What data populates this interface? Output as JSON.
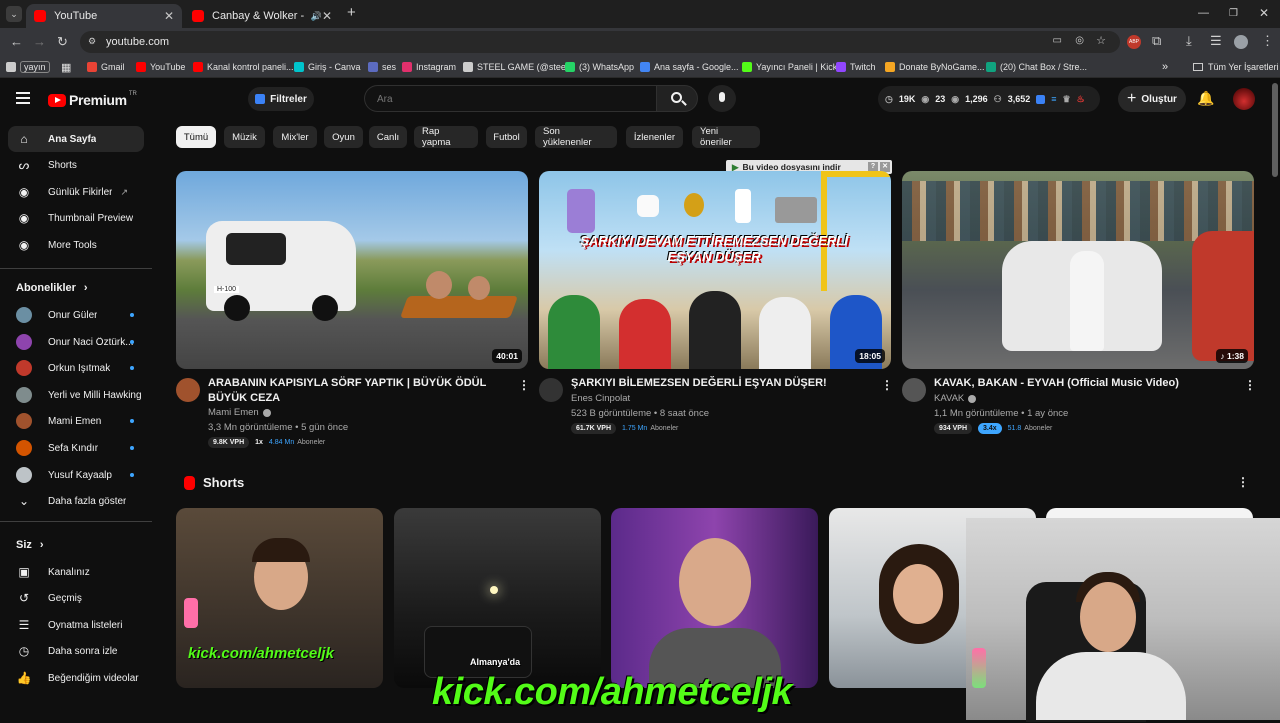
{
  "browser": {
    "tabs": [
      {
        "title": "YouTube",
        "active": true
      },
      {
        "title": "Canbay & Wolker - Bakkal (",
        "active": false
      }
    ],
    "new_tab": "+",
    "url": "youtube.com",
    "bookmarks": [
      {
        "label": "yayın",
        "color": "#5f6368"
      },
      {
        "label": "Gmail",
        "color": "#ea4335"
      },
      {
        "label": "YouTube",
        "color": "#ff0000"
      },
      {
        "label": "Kanal kontrol paneli...",
        "color": "#ff0000"
      },
      {
        "label": "Giriş - Canva",
        "color": "#00c4cc"
      },
      {
        "label": "ses",
        "color": "#5c6bc0"
      },
      {
        "label": "Instagram",
        "color": "#e1306c"
      },
      {
        "label": "STEEL GAME (@stee...",
        "color": "#cccccc"
      },
      {
        "label": "(3) WhatsApp",
        "color": "#25d366"
      },
      {
        "label": "Ana sayfa - Google...",
        "color": "#4285f4"
      },
      {
        "label": "Yayıncı Paneli | Kick",
        "color": "#53fc18"
      },
      {
        "label": "Twitch",
        "color": "#9146ff"
      },
      {
        "label": "Donate ByNoGame...",
        "color": "#f5a623"
      },
      {
        "label": "(20) Chat Box / Stre...",
        "color": "#10a37f"
      }
    ],
    "all_bookmarks": "Tüm Yer İşaretleri"
  },
  "header": {
    "logo_text": "Premium",
    "logo_sup": "TR",
    "filters_label": "Filtreler",
    "search_placeholder": "Ara",
    "stats": {
      "subs": "19K",
      "views": "23",
      "watch": "1,296",
      "users": "3,652"
    },
    "create_label": "Oluştur"
  },
  "sidebar": {
    "main": [
      {
        "label": "Ana Sayfa",
        "icon": "home-icon",
        "active": true
      },
      {
        "label": "Shorts",
        "icon": "shorts-icon"
      },
      {
        "label": "Günlük Fikirler",
        "icon": "lightbulb-icon"
      },
      {
        "label": "Thumbnail Preview",
        "icon": "image-icon"
      },
      {
        "label": "More Tools",
        "icon": "tools-icon"
      }
    ],
    "subs_title": "Abonelikler",
    "subs": [
      {
        "label": "Onur Güler",
        "color": "#6b8fa3",
        "dot": true
      },
      {
        "label": "Onur Naci Öztürk...",
        "color": "#8e44ad",
        "dot": true
      },
      {
        "label": "Orkun Işıtmak",
        "color": "#c0392b",
        "dot": true
      },
      {
        "label": "Yerli ve Milli Hawking",
        "color": "#7f8c8d",
        "dot": false
      },
      {
        "label": "Mami Emen",
        "color": "#a0522d",
        "dot": true
      },
      {
        "label": "Sefa Kındır",
        "color": "#d35400",
        "dot": true
      },
      {
        "label": "Yusuf Kayaalp",
        "color": "#bdc3c7",
        "dot": true
      }
    ],
    "show_more": "Daha fazla göster",
    "you_title": "Siz",
    "you": [
      {
        "label": "Kanalınız",
        "icon": "channel-icon"
      },
      {
        "label": "Geçmiş",
        "icon": "history-icon"
      },
      {
        "label": "Oynatma listeleri",
        "icon": "playlist-icon"
      },
      {
        "label": "Daha sonra izle",
        "icon": "clock-icon"
      },
      {
        "label": "Beğendiğim videolar",
        "icon": "like-icon"
      }
    ]
  },
  "chips": [
    "Tümü",
    "Müzik",
    "Mix'ler",
    "Oyun",
    "Canlı",
    "Rap yapma",
    "Futbol",
    "Son yüklenenler",
    "İzlenenler",
    "Yeni öneriler"
  ],
  "download_banner": "Bu video dosyasını indir",
  "videos": [
    {
      "title": "ARABANIN KAPISIYLA SÖRF YAPTIK | BÜYÜK ÖDÜL BÜYÜK CEZA",
      "channel": "Mami Emen",
      "meta": "3,3 Mn görüntüleme • 5 gün önce",
      "duration": "40:01",
      "thumb_text": "H-100",
      "vph": "9.8K VPH",
      "mult": "1x",
      "subs": "4.84 Mn",
      "subs_label": "Aboneler"
    },
    {
      "title": "ŞARKIYI BİLEMEZSEN DEĞERLİ EŞYAN DÜŞER!",
      "channel": "Enes Cinpolat",
      "meta": "523 B görüntüleme • 8 saat önce",
      "duration": "18:05",
      "thumb_text": "ŞARKIYI DEVAM ETTİREMEZSEN DEĞERLİ EŞYAN DÜŞER",
      "vph": "61.7K VPH",
      "subs": "1.75 Mn",
      "subs_label": "Aboneler"
    },
    {
      "title": "KAVAK, BAKAN - EYVAH  (Official Music Video)",
      "channel": "KAVAK",
      "meta": "1,1 Mn görüntüleme • 1 ay önce",
      "duration": "♪ 1:38",
      "vph": "934 VPH",
      "mult": "3.4x",
      "subs": "51.8",
      "subs_label": "Aboneler"
    }
  ],
  "shorts_title": "Shorts",
  "shorts": [
    {
      "overlay": "kick.com/ahmetceljk"
    },
    {
      "overlay": "Almanya'da"
    },
    {
      "overlay": ""
    },
    {
      "overlay": ""
    },
    {
      "overlay": ""
    }
  ],
  "stream_overlay": "kick.com/ahmetceljk"
}
